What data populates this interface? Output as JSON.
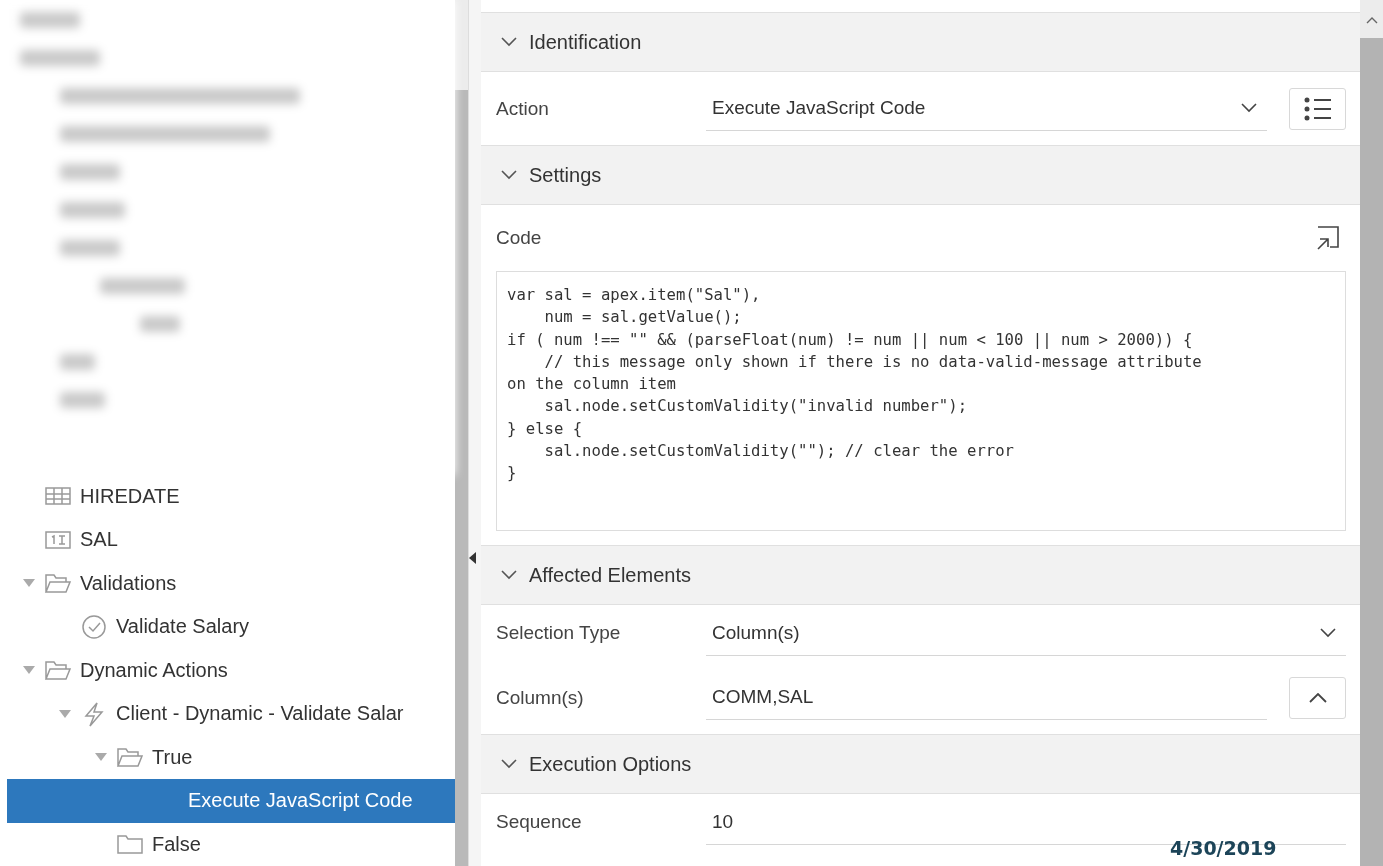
{
  "tree": [
    {
      "label": "HIREDATE",
      "kind": "table-column",
      "selected": false
    },
    {
      "label": "SAL",
      "kind": "number-column",
      "selected": false
    },
    {
      "label": "Validations",
      "kind": "folder",
      "expanded": true,
      "selected": false,
      "children": [
        {
          "label": "Validate Salary",
          "kind": "validation",
          "selected": false
        }
      ]
    },
    {
      "label": "Dynamic Actions",
      "kind": "folder",
      "expanded": true,
      "selected": false,
      "children": [
        {
          "label": "Client - Dynamic - Validate Salar",
          "kind": "dynamic-action",
          "expanded": true,
          "selected": false,
          "children": [
            {
              "label": "True",
              "kind": "folder",
              "expanded": true,
              "selected": false,
              "children": [
                {
                  "label": "Execute JavaScript Code",
                  "kind": "action",
                  "selected": true
                }
              ]
            },
            {
              "label": "False",
              "kind": "empty-folder",
              "selected": false
            }
          ]
        }
      ]
    }
  ],
  "properties": [
    {
      "group": "Identification",
      "expanded": true,
      "fields": [
        {
          "kind": "select",
          "label": "Action",
          "value": "Execute JavaScript Code",
          "list_button": true
        }
      ]
    },
    {
      "group": "Settings",
      "expanded": true,
      "fields": [
        {
          "kind": "code",
          "label": "Code",
          "lines": [
            "var sal = apex.item(\"Sal\"),",
            "    num = sal.getValue();",
            "if ( num !== \"\" && (parseFloat(num) != num || num < 100 || num > 2000)) {",
            "    // this message only shown if there is no data-valid-message attribute",
            "on the column item",
            "    sal.node.setCustomValidity(\"invalid number\");",
            "} else {",
            "    sal.node.setCustomValidity(\"\"); // clear the error",
            "}"
          ]
        }
      ]
    },
    {
      "group": "Affected Elements",
      "expanded": true,
      "fields": [
        {
          "kind": "select",
          "label": "Selection Type",
          "value": "Column(s)"
        },
        {
          "kind": "text",
          "label": "Column(s)",
          "value": "COMM,SAL",
          "collapse_button": true
        }
      ]
    },
    {
      "group": "Execution Options",
      "expanded": true,
      "fields": [
        {
          "kind": "text",
          "label": "Sequence",
          "value": "10"
        }
      ]
    }
  ],
  "date": "4/30/2019"
}
